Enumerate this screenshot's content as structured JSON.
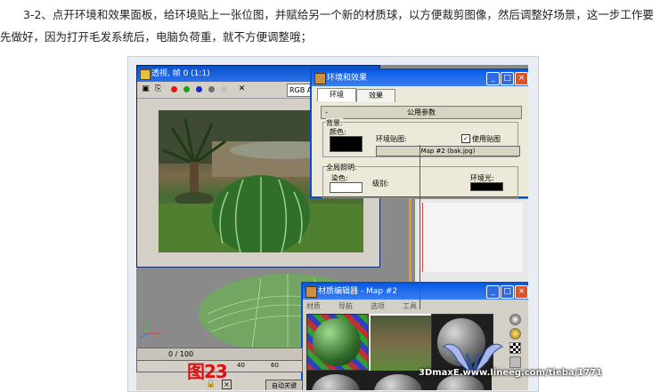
{
  "intro": {
    "line1": "3-2、点开环境和效果面板，给环境贴上一张位图，并赋给另一个新的材质球，以方便裁剪图像，然后调整好场景，这一步工作要",
    "line2": "先做好，因为打开毛发系统后，电脑负荷重，就不方便调整哦；"
  },
  "viewport": {
    "title": "透视, 帧 0 (1:1)",
    "channel": "RGB Alpha"
  },
  "env_dialog": {
    "title": "环境和效果",
    "tabs": [
      "环境",
      "效果"
    ],
    "rollout": "公用参数",
    "background_group": "背景:",
    "color_label": "颜色:",
    "env_map_label": "环境贴图:",
    "use_map_label": "使用贴图",
    "map_button": "Map #2 (bak.jpg)",
    "global_light_group": "全局照明:",
    "tint_label": "染色:",
    "level_label": "级别:",
    "ambient_label": "环境光:"
  },
  "mat_editor": {
    "title": "材质编辑器 - Map #2",
    "menu": [
      "材质",
      "导航",
      "选项",
      "工具"
    ]
  },
  "timeline": {
    "frames": "0 / 100",
    "tick_40": "40",
    "tick_60": "60",
    "autokey": "自动关键"
  },
  "figure_label": "图23",
  "watermark": "3DmaxE.www.lineeg.com/tieba/1771",
  "colors": {
    "title_bar": "#0a50c8",
    "caption_red": "#e01010",
    "frame_bg": "#e9eef4"
  }
}
